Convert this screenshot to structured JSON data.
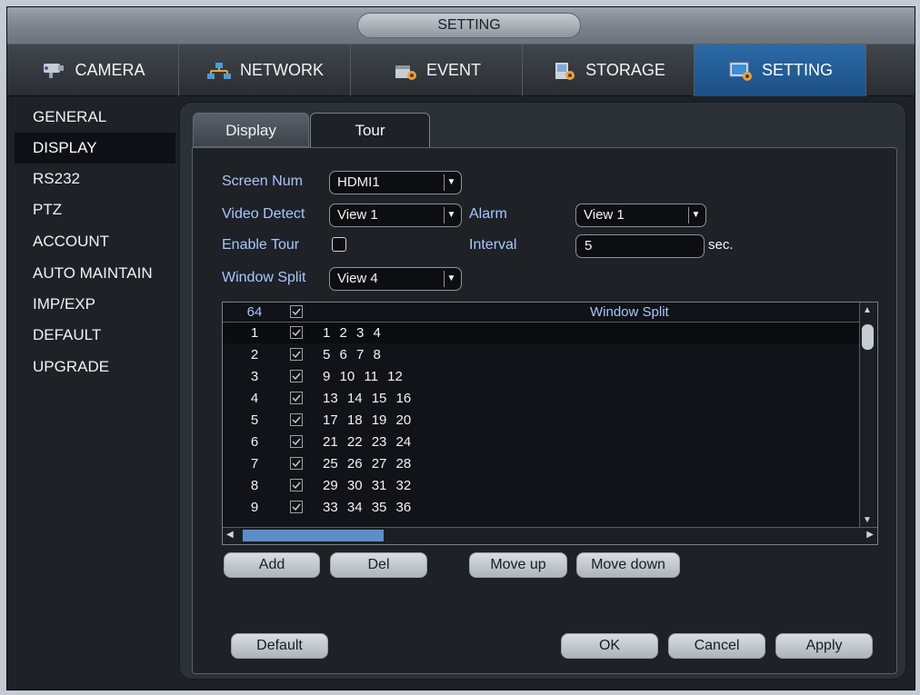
{
  "window": {
    "title": "SETTING"
  },
  "tabs": [
    {
      "label": "CAMERA",
      "icon": "camera-icon"
    },
    {
      "label": "NETWORK",
      "icon": "network-icon"
    },
    {
      "label": "EVENT",
      "icon": "event-icon"
    },
    {
      "label": "STORAGE",
      "icon": "storage-icon"
    },
    {
      "label": "SETTING",
      "icon": "setting-icon",
      "active": true
    }
  ],
  "sidebar": {
    "items": [
      "GENERAL",
      "DISPLAY",
      "RS232",
      "PTZ",
      "ACCOUNT",
      "AUTO MAINTAIN",
      "IMP/EXP",
      "DEFAULT",
      "UPGRADE"
    ],
    "active": "DISPLAY"
  },
  "subtabs": {
    "display": "Display",
    "tour": "Tour",
    "active": "Tour"
  },
  "form": {
    "screen_num_label": "Screen Num",
    "screen_num_value": "HDMI1",
    "video_detect_label": "Video Detect",
    "video_detect_value": "View 1",
    "alarm_label": "Alarm",
    "alarm_value": "View 1",
    "enable_tour_label": "Enable Tour",
    "enable_tour_checked": false,
    "interval_label": "Interval",
    "interval_value": "5",
    "interval_unit": "sec.",
    "window_split_label": "Window Split",
    "window_split_value": "View 4"
  },
  "table": {
    "header_num": "64",
    "header_split": "Window Split",
    "rows": [
      {
        "num": "1",
        "split": "1  2  3  4"
      },
      {
        "num": "2",
        "split": "5  6  7  8"
      },
      {
        "num": "3",
        "split": "9  10  11  12"
      },
      {
        "num": "4",
        "split": "13  14  15  16"
      },
      {
        "num": "5",
        "split": "17  18  19  20"
      },
      {
        "num": "6",
        "split": "21  22  23  24"
      },
      {
        "num": "7",
        "split": "25  26  27  28"
      },
      {
        "num": "8",
        "split": "29  30  31  32"
      },
      {
        "num": "9",
        "split": "33  34  35  36"
      }
    ]
  },
  "list_buttons": {
    "add": "Add",
    "del": "Del",
    "move_up": "Move up",
    "move_down": "Move down"
  },
  "footer_buttons": {
    "default": "Default",
    "ok": "OK",
    "cancel": "Cancel",
    "apply": "Apply"
  },
  "colors": {
    "accent": "#1c4f83",
    "label": "#a9c6ff",
    "background": "#1e2227"
  }
}
